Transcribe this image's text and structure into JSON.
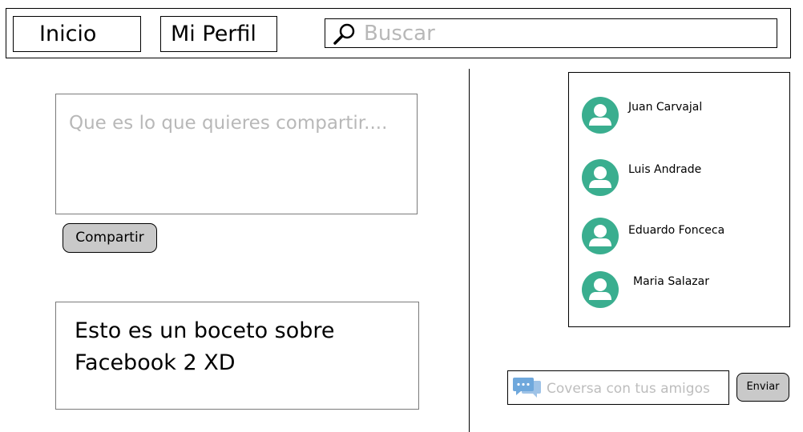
{
  "nav": {
    "home_label": "Inicio",
    "profile_label": "Mi Perfil"
  },
  "search": {
    "placeholder": "Buscar",
    "value": "",
    "icon": "search-icon"
  },
  "composer": {
    "placeholder": "Que es lo que quieres compartir....",
    "value": "",
    "share_label": "Compartir"
  },
  "post": {
    "text": "Esto es un boceto sobre Facebook 2 XD"
  },
  "friends": {
    "items": [
      {
        "name": "Juan Carvajal",
        "icon": "user-avatar-icon"
      },
      {
        "name": "Luis Andrade",
        "icon": "user-avatar-icon"
      },
      {
        "name": "Eduardo Fonceca",
        "icon": "user-avatar-icon"
      },
      {
        "name": "Maria Salazar",
        "icon": "user-avatar-icon"
      }
    ]
  },
  "chat": {
    "placeholder": "Coversa con tus amigos",
    "value": "",
    "send_label": "Enviar",
    "icon": "chat-bubbles-icon"
  },
  "colors": {
    "avatar_bg": "#3aae8f",
    "button_bg": "#c9c9c9",
    "placeholder": "#b8b8b8",
    "chat_icon": "#6fa8dc"
  }
}
